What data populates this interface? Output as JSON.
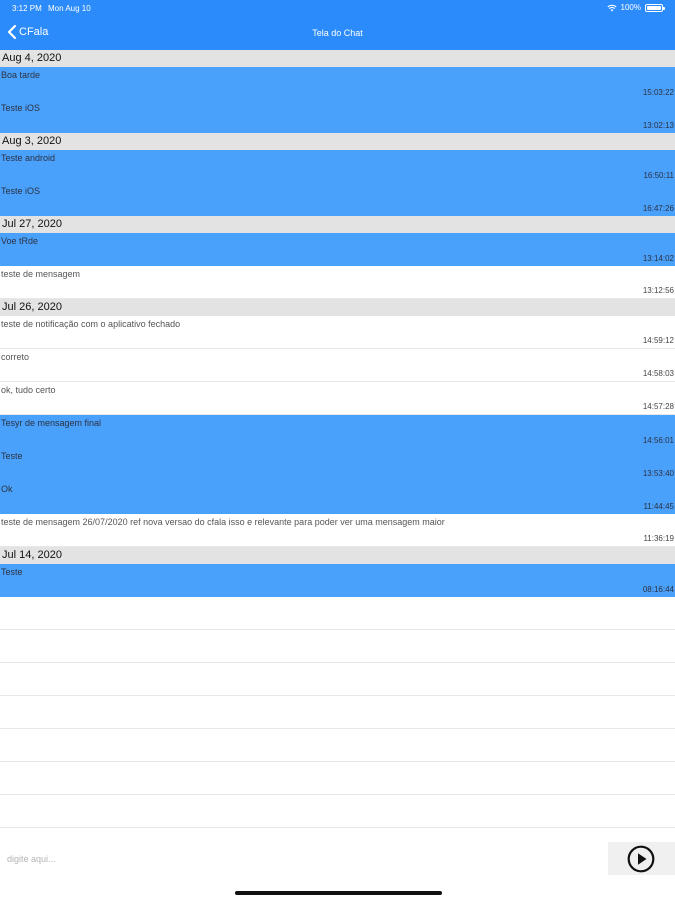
{
  "status_bar": {
    "time": "3:12 PM",
    "date": "Mon Aug 10",
    "battery": "100%"
  },
  "nav": {
    "back_label": "CFala",
    "title": "Tela do Chat"
  },
  "sections": [
    {
      "date": "Aug 4, 2020",
      "messages": [
        {
          "text": "Boa tarde",
          "time": "15:03:22",
          "mine": true
        },
        {
          "text": "Teste iOS",
          "time": "13:02:13",
          "mine": true
        }
      ]
    },
    {
      "date": "Aug 3, 2020",
      "messages": [
        {
          "text": "Teste android",
          "time": "16:50:11",
          "mine": true
        },
        {
          "text": "Teste iOS",
          "time": "16:47:26",
          "mine": true
        }
      ]
    },
    {
      "date": "Jul 27, 2020",
      "messages": [
        {
          "text": "Voe tRde",
          "time": "13:14:02",
          "mine": true
        },
        {
          "text": "teste de mensagem",
          "time": "13:12:56",
          "mine": false
        }
      ]
    },
    {
      "date": "Jul 26, 2020",
      "messages": [
        {
          "text": "teste de notificação com o aplicativo fechado",
          "time": "14:59:12",
          "mine": false
        },
        {
          "text": "correto",
          "time": "14:58:03",
          "mine": false
        },
        {
          "text": "ok, tudo certo",
          "time": "14:57:28",
          "mine": false
        },
        {
          "text": "Tesyr de mensagem final",
          "time": "14:56:01",
          "mine": true
        },
        {
          "text": "Teste",
          "time": "13:53:40",
          "mine": true
        },
        {
          "text": "Ok",
          "time": "11:44:45",
          "mine": true
        },
        {
          "text": "teste de mensagem 26/07/2020 ref nova versao do cfala isso e relevante para poder ver uma mensagem maior",
          "time": "11:36:19",
          "mine": false
        }
      ]
    },
    {
      "date": "Jul 14, 2020",
      "messages": [
        {
          "text": "Teste",
          "time": "08:16:44",
          "mine": true
        }
      ]
    }
  ],
  "composer": {
    "placeholder": "digite aqui..."
  },
  "icons": {
    "back": "chevron-left-icon",
    "send": "play-circle-icon",
    "wifi": "wifi-icon",
    "battery": "battery-icon"
  },
  "colors": {
    "nav": "#2b8bfa",
    "mine": "#4aa1fc",
    "section": "#e3e3e3"
  }
}
